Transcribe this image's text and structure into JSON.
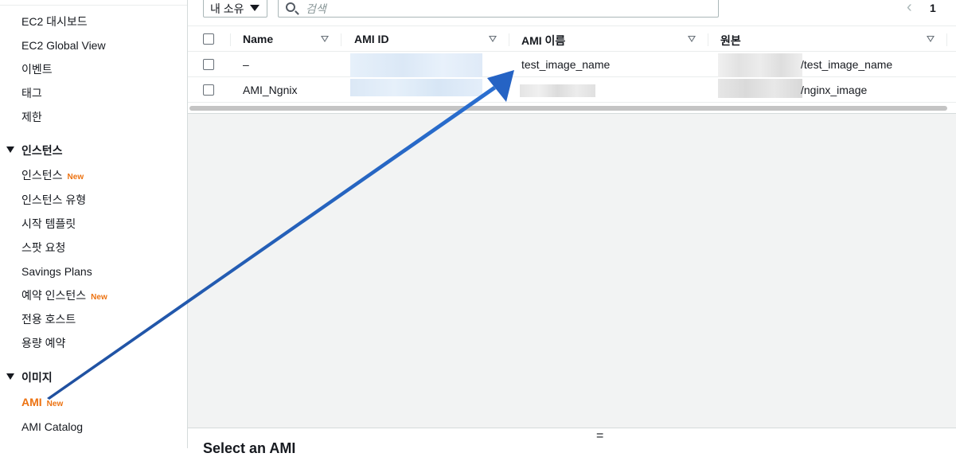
{
  "sidebar": {
    "items_top": [
      {
        "label": "EC2 대시보드"
      },
      {
        "label": "EC2 Global View"
      },
      {
        "label": "이벤트"
      },
      {
        "label": "태그"
      },
      {
        "label": "제한"
      }
    ],
    "section_instances": {
      "title": "인스턴스",
      "items": [
        {
          "label": "인스턴스",
          "badge": "New"
        },
        {
          "label": "인스턴스 유형"
        },
        {
          "label": "시작 템플릿"
        },
        {
          "label": "스팟 요청"
        },
        {
          "label": "Savings Plans"
        },
        {
          "label": "예약 인스턴스",
          "badge": "New"
        },
        {
          "label": "전용 호스트"
        },
        {
          "label": "용량 예약"
        }
      ]
    },
    "section_images": {
      "title": "이미지",
      "items": [
        {
          "label": "AMI",
          "badge": "New",
          "active": true
        },
        {
          "label": "AMI Catalog"
        }
      ]
    }
  },
  "toolbar": {
    "owner_filter": "내 소유",
    "search_placeholder": "검색",
    "page_number": "1"
  },
  "table": {
    "columns": [
      "Name",
      "AMI ID",
      "AMI 이름",
      "원본"
    ],
    "rows": [
      {
        "name": "–",
        "ami_id": "",
        "ami_name": "test_image_name",
        "source": "/test_image_name"
      },
      {
        "name": "AMI_Ngnix",
        "ami_id": "",
        "ami_name": "",
        "source": "/nginx_image"
      }
    ]
  },
  "detail_panel": {
    "handle": "=",
    "title": "Select an AMI"
  },
  "colors": {
    "accent": "#ec7211",
    "arrow": "#1f5fbf"
  }
}
